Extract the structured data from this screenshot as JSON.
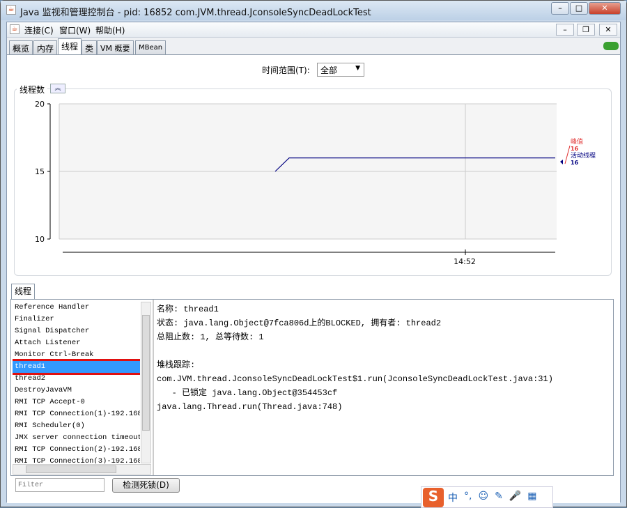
{
  "window": {
    "title": "Java 监视和管理控制台 - pid: 16852 com.JVM.thread.JconsoleSyncDeadLockTest",
    "minimize": "–",
    "maximize": "□",
    "close": "✕"
  },
  "menu": [
    "连接(C)",
    "窗口(W)",
    "帮助(H)"
  ],
  "inner_controls": {
    "minimize": "–",
    "restore": "❐",
    "close": "✕"
  },
  "tabs": [
    "概览",
    "内存",
    "线程",
    "类",
    "VM 概要",
    "MBean"
  ],
  "active_tab": "线程",
  "time_range": {
    "label": "时间范围(T):",
    "value": "全部"
  },
  "chart_data": {
    "type": "line",
    "title": "线程数",
    "collapse_icon": "double-chevron-up",
    "y_ticks": [
      "20",
      "15",
      "10"
    ],
    "ylim": [
      10,
      20
    ],
    "x_ticks": [
      "14:52"
    ],
    "series": [
      {
        "name": "活动线程",
        "color": "#000080",
        "points": [
          [
            0,
            15
          ],
          [
            0.05,
            16
          ],
          [
            1,
            16
          ]
        ]
      }
    ],
    "legend": {
      "peak_label": "峰值",
      "peak_value": "16",
      "live_label": "活动线程",
      "live_value": "16",
      "peak_color": "#e03030",
      "live_color": "#000080"
    }
  },
  "threads_panel": {
    "tab": "线程",
    "threads": [
      "Reference Handler",
      "Finalizer",
      "Signal Dispatcher",
      "Attach Listener",
      "Monitor Ctrl-Break",
      "thread1",
      "thread2",
      "DestroyJavaVM",
      "RMI TCP Accept-0",
      "RMI TCP Connection(1)-192.168.",
      "RMI Scheduler(0)",
      "JMX server connection timeout",
      "RMI TCP Connection(2)-192.168.",
      "RMI TCP Connection(3)-192.168."
    ],
    "selected": "thread1",
    "details": [
      "名称: thread1",
      "状态: java.lang.Object@7fca806d上的BLOCKED, 拥有者: thread2",
      "总阻止数: 1, 总等待数: 1",
      "",
      "堆栈跟踪:",
      "com.JVM.thread.JconsoleSyncDeadLockTest$1.run(JconsoleSyncDeadLockTest.java:31)",
      "   - 已锁定 java.lang.Object@354453cf",
      "java.lang.Thread.run(Thread.java:748)"
    ],
    "filter_placeholder": "Filter",
    "detect_button": "检测死锁(D)"
  },
  "ime": {
    "logo": "S",
    "items": [
      "中",
      "°,",
      "☺",
      "✎",
      "🎤",
      "▦"
    ]
  }
}
